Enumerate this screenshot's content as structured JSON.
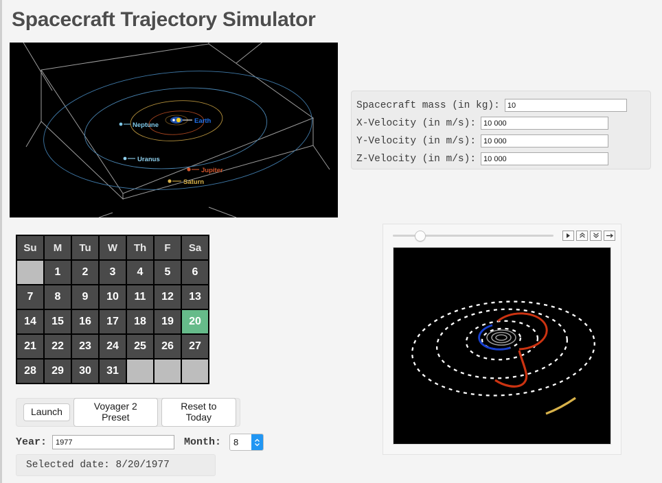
{
  "header": {
    "title": "Spacecraft Trajectory Simulator"
  },
  "viz3d": {
    "name": "solar-system-3d-view",
    "background": "#000000",
    "planets": [
      {
        "label": "Neptune",
        "color": "#7ec8e8"
      },
      {
        "label": "Uranus",
        "color": "#8fd0ee"
      },
      {
        "label": "Saturn",
        "color": "#d8b24a"
      },
      {
        "label": "Jupiter",
        "color": "#d4542a"
      },
      {
        "label": "Earth",
        "color": "#1f6fe8"
      }
    ]
  },
  "params": {
    "mass": {
      "label": "Spacecraft mass (in kg):",
      "value": "10"
    },
    "vx": {
      "label": "X-Velocity (in m/s):",
      "value": "10 000"
    },
    "vy": {
      "label": "Y-Velocity (in m/s):",
      "value": "10 000"
    },
    "vz": {
      "label": "Z-Velocity (in m/s):",
      "value": "10 000"
    }
  },
  "calendar": {
    "weekdays": [
      "Su",
      "M",
      "Tu",
      "W",
      "Th",
      "F",
      "Sa"
    ],
    "weeks": [
      [
        "",
        "1",
        "2",
        "3",
        "4",
        "5",
        "6"
      ],
      [
        "7",
        "8",
        "9",
        "10",
        "11",
        "12",
        "13"
      ],
      [
        "14",
        "15",
        "16",
        "17",
        "18",
        "19",
        "20"
      ],
      [
        "21",
        "22",
        "23",
        "24",
        "25",
        "26",
        "27"
      ],
      [
        "28",
        "29",
        "30",
        "31",
        "",
        "",
        ""
      ]
    ],
    "selected_day": "20",
    "selected_color": "#66bb8a"
  },
  "buttons": {
    "launch": "Launch",
    "preset": "Voyager 2 Preset",
    "reset": "Reset to Today"
  },
  "date_controls": {
    "year_label": "Year:",
    "year_value": "1977",
    "month_label": "Month:",
    "month_value": "8"
  },
  "status": {
    "selected_date": "Selected date: 8/20/1977"
  },
  "animation": {
    "slider_position_pct": "16",
    "controls": [
      {
        "name": "play-button",
        "icon": "play-icon"
      },
      {
        "name": "speed-up-button",
        "icon": "chevron-double-up-icon"
      },
      {
        "name": "speed-down-button",
        "icon": "chevron-double-down-icon"
      },
      {
        "name": "step-forward-button",
        "icon": "arrow-right-icon"
      }
    ],
    "trajectory_colors": {
      "orbit_dashed": "#ffffff",
      "spacecraft": "#cc3311",
      "inner_blue": "#1740d0",
      "outer_gold": "#d8b24a",
      "grey_rings": "#9a9a9a"
    }
  }
}
